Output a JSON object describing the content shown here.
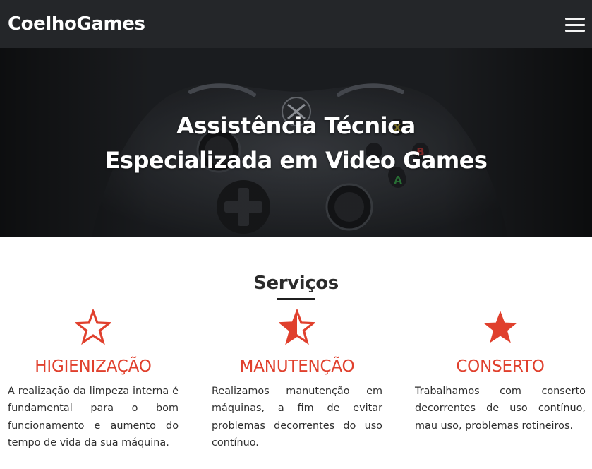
{
  "navbar": {
    "brand": "CoelhoGames",
    "menu_icon": "hamburger-icon"
  },
  "hero": {
    "title_line1": "Assistência Técnica",
    "title_line2": "Especializada em Video Games",
    "background": "game-controller-photo"
  },
  "services": {
    "title": "Serviços",
    "accent_color": "#e0402d",
    "items": [
      {
        "icon": "star-outline-icon",
        "title": "HIGIENIZAÇÃO",
        "text": "A realização da limpeza interna é fundamental para o bom funcionamento e aumento do tempo de vida da sua máquina."
      },
      {
        "icon": "star-half-icon",
        "title": "MANUTENÇÃO",
        "text": "Realizamos manutenção em máquinas, a fim de evitar problemas decorrentes do uso contínuo."
      },
      {
        "icon": "star-filled-icon",
        "title": "CONSERTO",
        "text": "Trabalhamos com conserto decorrentes de uso contínuo, mau uso, problemas rotineiros."
      }
    ]
  }
}
